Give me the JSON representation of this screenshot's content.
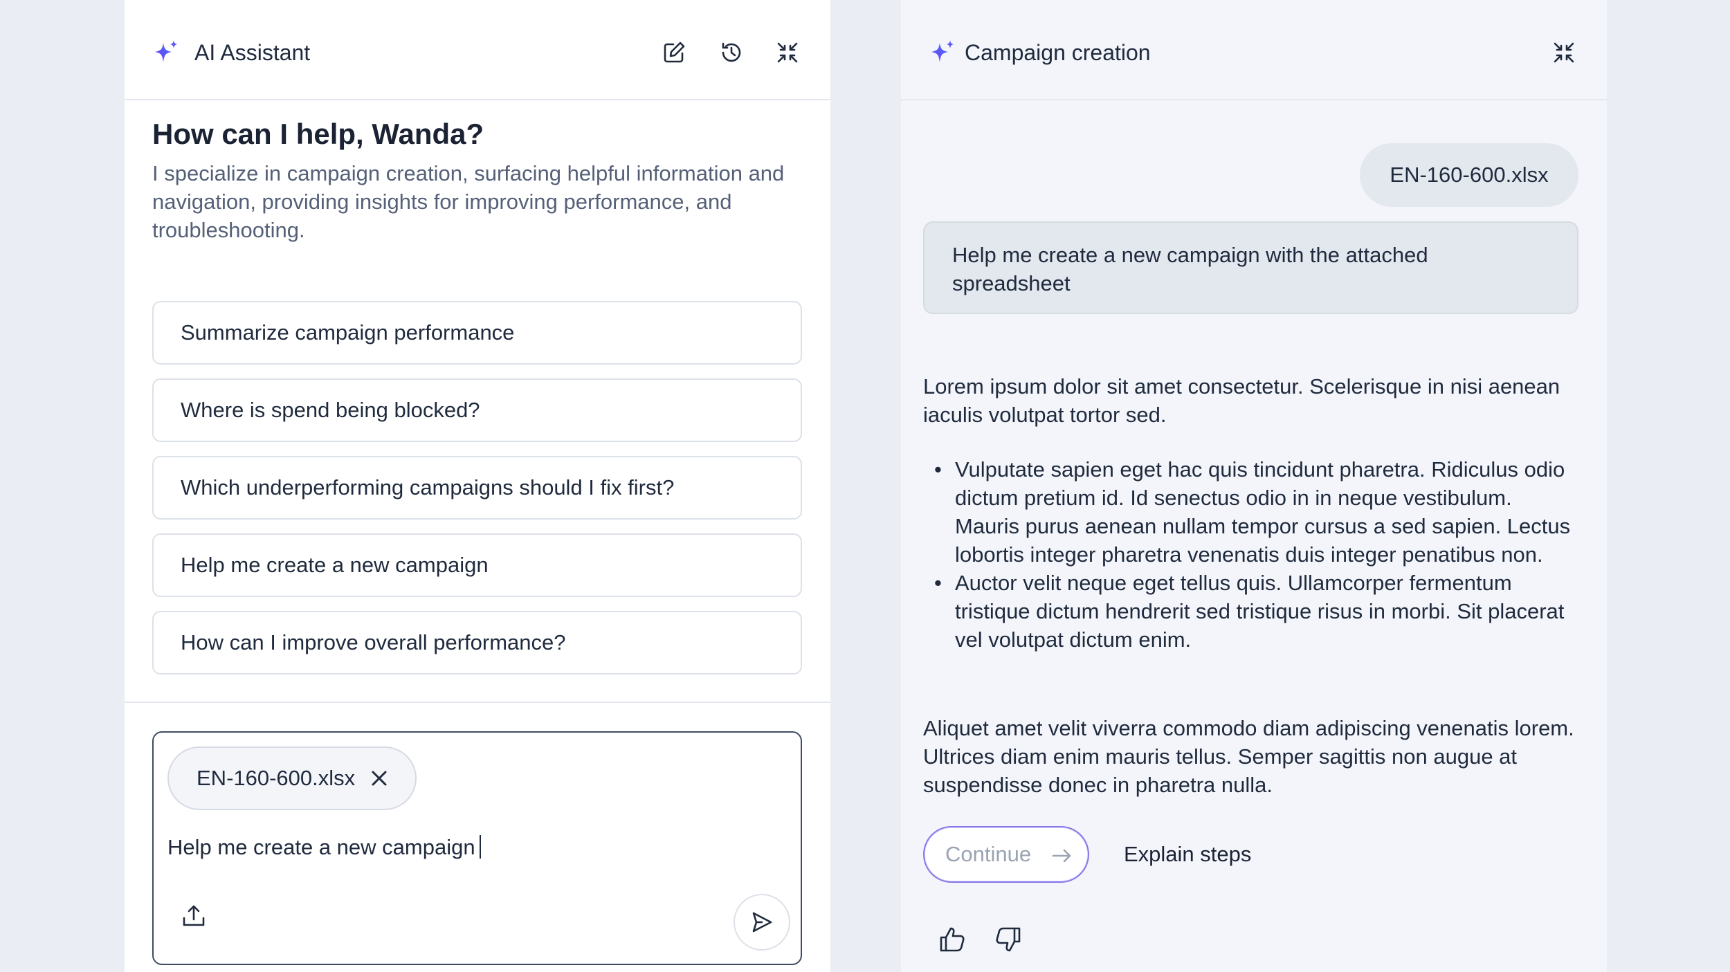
{
  "left_panel": {
    "header": {
      "title": "AI Assistant",
      "icons": [
        "sparkle-icon",
        "edit-icon",
        "history-icon",
        "collapse-icon"
      ]
    },
    "greeting": "How can I help, Wanda?",
    "subtext": "I specialize in campaign creation, surfacing helpful information and navigation, providing insights for improving performance, and troubleshooting.",
    "suggestions": [
      "Summarize campaign performance",
      "Where is spend being blocked?",
      "Which underperforming campaigns should I fix first?",
      "Help me create a new campaign",
      "How can I improve overall performance?"
    ],
    "composer": {
      "attachment": "EN-160-600.xlsx",
      "input_value": "Help me create a new campaign",
      "icons": [
        "close-icon",
        "upload-icon",
        "send-icon"
      ]
    }
  },
  "right_panel": {
    "header": {
      "title": "Campaign creation",
      "icons": [
        "sparkle-icon",
        "collapse-icon"
      ]
    },
    "user_file": "EN-160-600.xlsx",
    "user_message": "Help me create a new campaign with the attached spreadsheet",
    "response": {
      "intro": "Lorem ipsum dolor sit amet consectetur. Scelerisque in nisi aenean iaculis volutpat tortor sed.",
      "bullets": [
        "Vulputate sapien eget hac quis tincidunt pharetra. Ridiculus odio dictum pretium id. Id senectus odio in in neque vestibulum. Mauris purus aenean nullam tempor cursus a sed sapien. Lectus lobortis integer pharetra venenatis duis integer penatibus non.",
        "Auctor velit neque eget tellus quis. Ullamcorper fermentum tristique dictum hendrerit sed tristique risus in morbi. Sit placerat vel volutpat dictum enim."
      ],
      "outro": "Aliquet amet velit viverra commodo diam adipiscing venenatis lorem. Ultrices diam enim mauris tellus. Semper sagittis non augue at suspendisse donec in pharetra nulla."
    },
    "actions": {
      "continue_label": "Continue",
      "explain_label": "Explain steps"
    },
    "feedback_icons": [
      "thumbs-up-icon",
      "thumbs-down-icon"
    ]
  },
  "colors": {
    "accent": "#6b3ff2",
    "accent_light": "#4c6ef5",
    "text": "#1f2a3d",
    "muted": "#556078"
  }
}
